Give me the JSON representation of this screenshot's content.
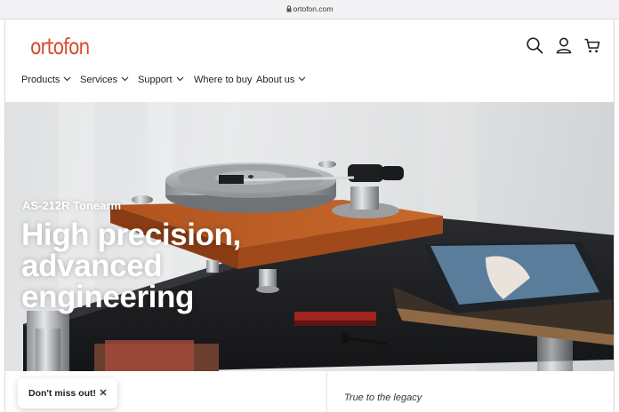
{
  "browser": {
    "url": "ortofon.com"
  },
  "header": {
    "logo": "ortofon",
    "icons": [
      "search-icon",
      "account-icon",
      "cart-icon"
    ]
  },
  "nav": {
    "items": [
      {
        "label": "Products"
      },
      {
        "label": "Services"
      },
      {
        "label": "Support"
      },
      {
        "label": "Where to buy"
      },
      {
        "label": "About us"
      }
    ]
  },
  "hero": {
    "eyebrow": "AS-212R Tonearm",
    "headline": [
      "High precision,",
      "advanced",
      "engineering"
    ]
  },
  "secondary": {
    "text": "True to the legacy"
  },
  "toast": {
    "label": "Don't miss out!"
  },
  "colors": {
    "brand": "#d84a2f",
    "heroText": "#ffffff"
  }
}
